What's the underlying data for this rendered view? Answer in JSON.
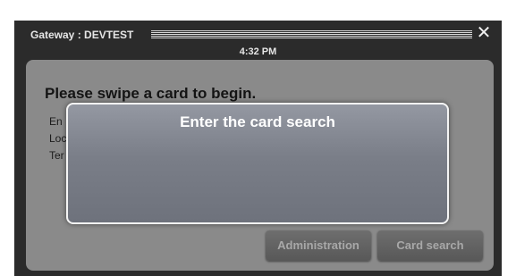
{
  "window": {
    "title": "Gateway : DEVTEST",
    "time": "4:32 PM",
    "close_glyph": "✕"
  },
  "main": {
    "prompt": "Please swipe a card to begin.",
    "info_lines": [
      "En",
      "Loc",
      "Ter"
    ]
  },
  "buttons": {
    "administration": "Administration",
    "card_search": "Card search"
  },
  "dialog": {
    "title": "Enter the card search"
  }
}
